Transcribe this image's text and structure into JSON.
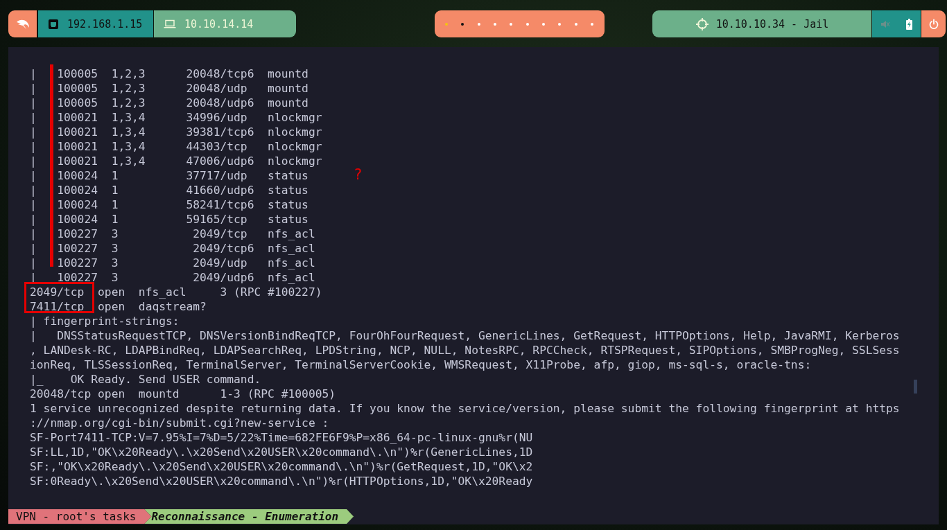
{
  "top_bar": {
    "local_ip": "192.168.1.15",
    "vpn_ip": "10.10.14.14",
    "workspaces": [
      {
        "color": "#f5c211"
      },
      {
        "color": "#111111"
      },
      {
        "color": "#ffffff"
      },
      {
        "color": "#ffffff"
      },
      {
        "color": "#ffffff"
      },
      {
        "color": "#ffffff"
      },
      {
        "color": "#ffffff"
      },
      {
        "color": "#ffffff"
      },
      {
        "color": "#ffffff"
      },
      {
        "color": "#ffffff"
      }
    ],
    "target": "10.10.10.34 - Jail"
  },
  "terminal": {
    "lines": [
      "|   100005  1,2,3      20048/tcp6  mountd",
      "|   100005  1,2,3      20048/udp   mountd",
      "|   100005  1,2,3      20048/udp6  mountd",
      "|   100021  1,3,4      34996/udp   nlockmgr",
      "|   100021  1,3,4      39381/tcp6  nlockmgr",
      "|   100021  1,3,4      44303/tcp   nlockmgr",
      "|   100021  1,3,4      47006/udp6  nlockmgr",
      "|   100024  1          37717/udp   status",
      "|   100024  1          41660/udp6  status",
      "|   100024  1          58241/tcp6  status",
      "|   100024  1          59165/tcp   status",
      "|   100227  3           2049/tcp   nfs_acl",
      "|   100227  3           2049/tcp6  nfs_acl",
      "|   100227  3           2049/udp   nfs_acl",
      "|_  100227  3           2049/udp6  nfs_acl",
      "2049/tcp  open  nfs_acl     3 (RPC #100227)",
      "7411/tcp  open  daqstream?",
      "| fingerprint-strings:",
      "|   DNSStatusRequestTCP, DNSVersionBindReqTCP, FourOhFourRequest, GenericLines, GetRequest, HTTPOptions, Help, JavaRMI, Kerberos",
      ", LANDesk-RC, LDAPBindReq, LDAPSearchReq, LPDString, NCP, NULL, NotesRPC, RPCCheck, RTSPRequest, SIPOptions, SMBProgNeg, SSLSess",
      "ionReq, TLSSessionReq, TerminalServer, TerminalServerCookie, WMSRequest, X11Probe, afp, giop, ms-sql-s, oracle-tns:",
      "|_    OK Ready. Send USER command.",
      "20048/tcp open  mountd      1-3 (RPC #100005)",
      "1 service unrecognized despite returning data. If you know the service/version, please submit the following fingerprint at https",
      "://nmap.org/cgi-bin/submit.cgi?new-service :",
      "SF-Port7411-TCP:V=7.95%I=7%D=5/22%Time=682FE6F9%P=x86_64-pc-linux-gnu%r(NU",
      "SF:LL,1D,\"OK\\x20Ready\\.\\x20Send\\x20USER\\x20command\\.\\n\")%r(GenericLines,1D",
      "SF:,\"OK\\x20Ready\\.\\x20Send\\x20USER\\x20command\\.\\n\")%r(GetRequest,1D,\"OK\\x2",
      "SF:0Ready\\.\\x20Send\\x20USER\\x20command\\.\\n\")%r(HTTPOptions,1D,\"OK\\x20Ready"
    ],
    "annotation_mark": "?"
  },
  "status_bar": {
    "session": "VPN - root's tasks",
    "window": "Reconnaissance - Enumeration"
  }
}
